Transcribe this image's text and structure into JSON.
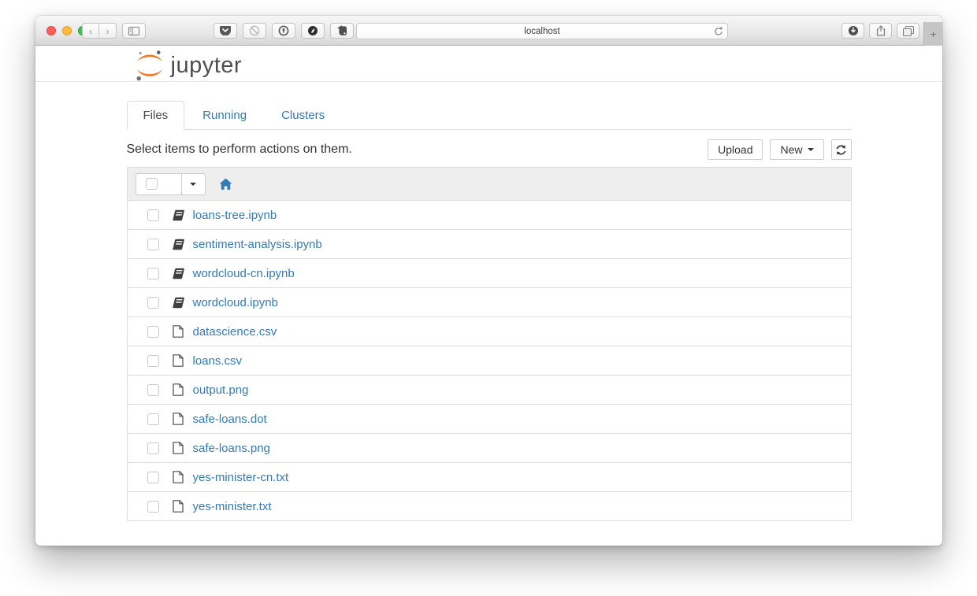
{
  "browser": {
    "window_controls": [
      "close",
      "minimize",
      "zoom"
    ],
    "nav_icons": [
      "back-icon",
      "forward-icon",
      "sidebar-icon"
    ],
    "back_glyph": "‹",
    "forward_glyph": "›",
    "extension_icons": [
      "pocket-icon",
      "blocked-icon",
      "onepassword-icon",
      "adblock-icon",
      "evernote-icon"
    ],
    "address": {
      "value": "localhost",
      "reload_icon": "reload-icon"
    },
    "right_icons": [
      "downloads-icon",
      "share-icon",
      "tab-overview-icon"
    ],
    "new_tab_glyph": "+"
  },
  "header": {
    "logo_icon": "jupyter-logo",
    "logo_text": "jupyter"
  },
  "tabs": [
    {
      "label": "Files",
      "active": true
    },
    {
      "label": "Running",
      "active": false
    },
    {
      "label": "Clusters",
      "active": false
    }
  ],
  "toolbar": {
    "message": "Select items to perform actions on them.",
    "upload_label": "Upload",
    "new_label": "New",
    "new_caret_icon": "caret-down-icon",
    "refresh_icon": "refresh-icon"
  },
  "list_header": {
    "select_all_icon": "select-all-checkbox",
    "dropdown_icon": "caret-down-icon",
    "home_icon": "home-icon"
  },
  "files": [
    {
      "label": "loans-tree.ipynb",
      "icon": "notebook-icon"
    },
    {
      "label": "sentiment-analysis.ipynb",
      "icon": "notebook-icon"
    },
    {
      "label": "wordcloud-cn.ipynb",
      "icon": "notebook-icon"
    },
    {
      "label": "wordcloud.ipynb",
      "icon": "notebook-icon"
    },
    {
      "label": "datascience.csv",
      "icon": "file-icon"
    },
    {
      "label": "loans.csv",
      "icon": "file-icon"
    },
    {
      "label": "output.png",
      "icon": "file-icon"
    },
    {
      "label": "safe-loans.dot",
      "icon": "file-icon"
    },
    {
      "label": "safe-loans.png",
      "icon": "file-icon"
    },
    {
      "label": "yes-minister-cn.txt",
      "icon": "file-icon"
    },
    {
      "label": "yes-minister.txt",
      "icon": "file-icon"
    }
  ],
  "colors": {
    "link_blue": "#337ab7",
    "jupyter_orange": "#f37726",
    "list_header_bg": "#eeeeee",
    "border_gray": "#dddddd"
  }
}
